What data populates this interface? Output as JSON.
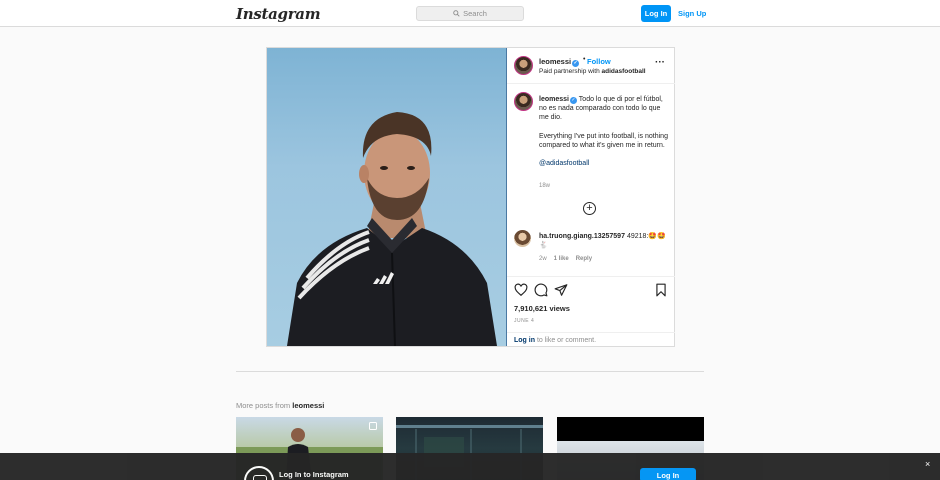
{
  "header": {
    "logo_text": "Instagram",
    "search_placeholder": "Search",
    "login_label": "Log In",
    "signup_label": "Sign Up"
  },
  "post": {
    "username": "leomessi",
    "verified": true,
    "follow_label": "Follow",
    "partner_prefix": "Paid partnership with",
    "partner_name": "adidasfootball",
    "caption_user": "leomessi",
    "caption_line1": "Todo lo que di por el fútbol, no es nada comparado con todo lo que me dio.",
    "caption_line2": "Everything I've put into football, is nothing compared to what it's given me in return.",
    "caption_mention": "@adidasfootball",
    "caption_age": "18w",
    "comment": {
      "user": "ha.truong.giang.13257597",
      "text": "49218:🤩🤩🐇",
      "age": "2w",
      "likes": "1 like",
      "reply_label": "Reply"
    },
    "views": "7,910,621 views",
    "date": "JUNE 4",
    "login_link": "Log in",
    "login_suffix": " to like or comment."
  },
  "more_posts": {
    "prefix": "More posts from ",
    "user": "leomessi"
  },
  "banner": {
    "title": "Log In to Instagram",
    "button_label": "Log In",
    "close_label": "×"
  },
  "colors": {
    "accent": "#0095f6",
    "link_dark": "#00376b",
    "verified": "#3897f0"
  }
}
